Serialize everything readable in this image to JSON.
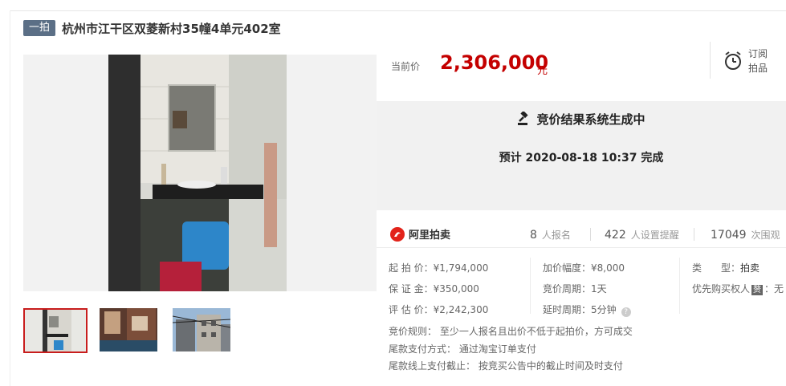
{
  "title": {
    "badge": "一拍",
    "text": "杭州市江干区双菱新村35幢4单元402室"
  },
  "price": {
    "label": "当前价",
    "value": "2,306,000",
    "unit": "元"
  },
  "subscribe": {
    "line1": "订阅",
    "line2": "拍品"
  },
  "result": {
    "title": "竞价结果系统生成中",
    "time": "预计 2020-08-18 10:37 完成"
  },
  "platform": {
    "name": "阿里拍卖"
  },
  "stats": {
    "signup": {
      "num": "8",
      "label": "人报名"
    },
    "reminder": {
      "num": "422",
      "label": "人设置提醒"
    },
    "views": {
      "num": "17049",
      "label": "次围观"
    }
  },
  "details": {
    "start_price": "起 拍 价：¥1,794,000",
    "deposit": "保 证 金：¥350,000",
    "appraisal": "评 估 价：¥2,242,300",
    "increment": "加价幅度：¥8,000",
    "cycle": "竞价周期：1天",
    "delay": "延时周期：5分钟",
    "type_label": "类　　型：",
    "type_value": "拍卖",
    "priority_label": "优先购买权人",
    "priority_tag": "赘",
    "priority_value": "：无"
  },
  "rules": [
    "竞价规则： 至少一人报名且出价不低于起拍价，方可成交",
    "尾款支付方式： 通过淘宝订单支付",
    "尾款线上支付截止： 按竞买公告中的截止时间及时支付"
  ],
  "colors": {
    "price": "#c40000",
    "badge": "#5b6f86",
    "thumb_active": "#c81d1d",
    "brand": "#e2231a"
  }
}
